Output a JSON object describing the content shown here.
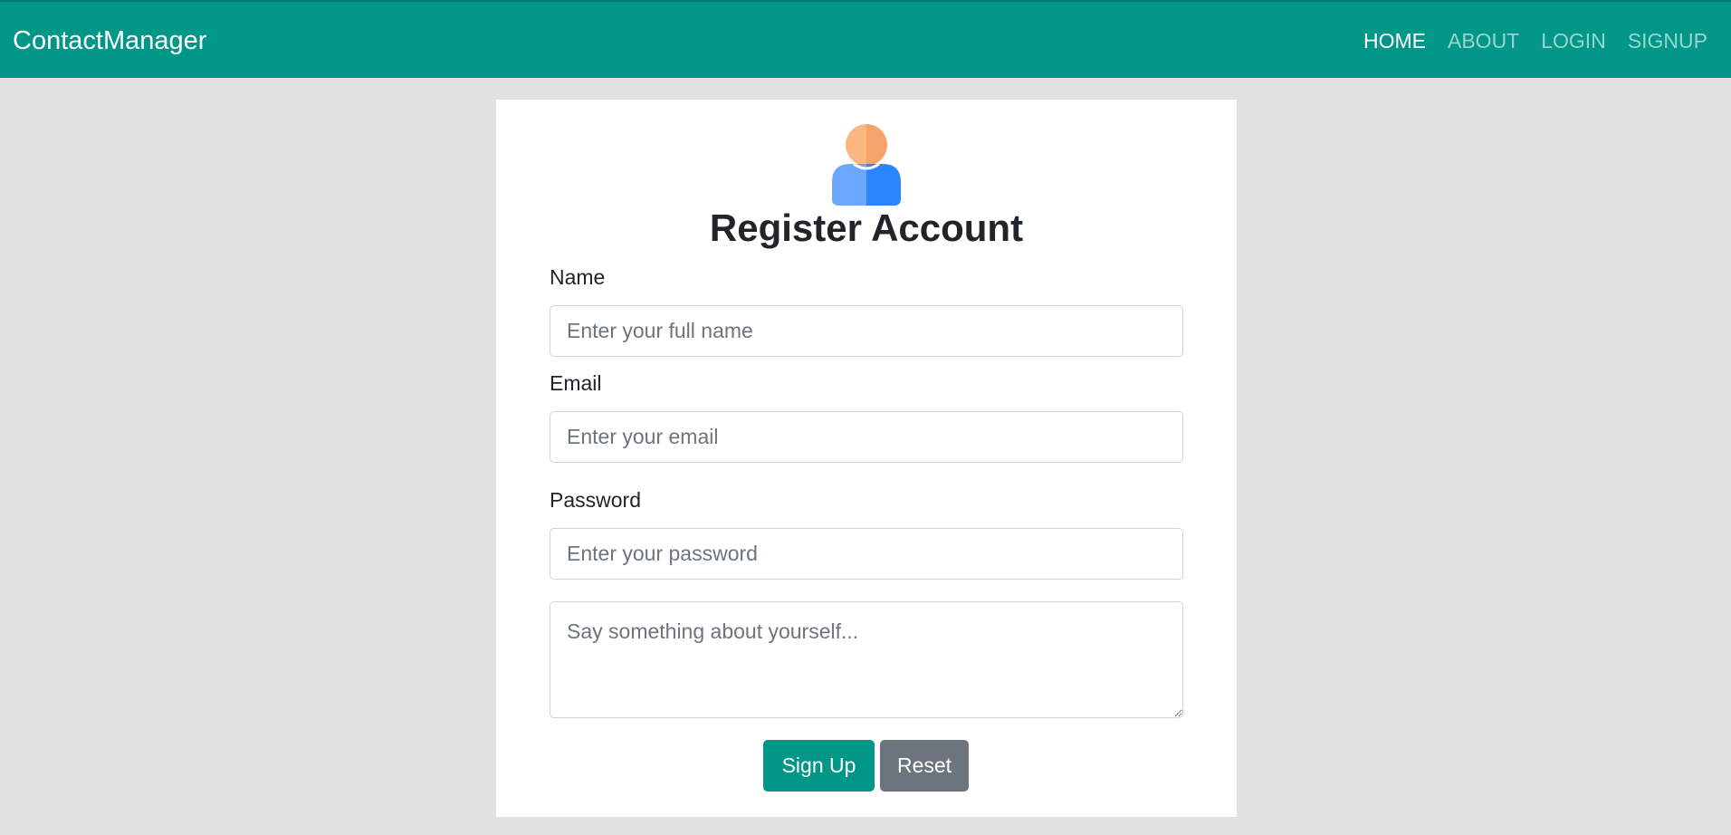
{
  "navbar": {
    "brand": "ContactManager",
    "links": [
      {
        "label": "HOME",
        "active": true
      },
      {
        "label": "ABOUT",
        "active": false
      },
      {
        "label": "LOGIN",
        "active": false
      },
      {
        "label": "SIGNUP",
        "active": false
      }
    ],
    "background_color": "#009688"
  },
  "form": {
    "avatar_icon": "user-avatar-icon",
    "title": "Register Account",
    "name": {
      "label": "Name",
      "placeholder": "Enter your full name",
      "value": ""
    },
    "email": {
      "label": "Email",
      "placeholder": "Enter your email",
      "value": ""
    },
    "password": {
      "label": "Password",
      "placeholder": "Enter your password",
      "value": ""
    },
    "about": {
      "placeholder": "Say something about yourself...",
      "value": ""
    },
    "buttons": {
      "signup_label": "Sign Up",
      "reset_label": "Reset"
    }
  },
  "colors": {
    "primary": "#009688",
    "secondary": "#6c757d",
    "page_background": "#e2e2e2"
  }
}
